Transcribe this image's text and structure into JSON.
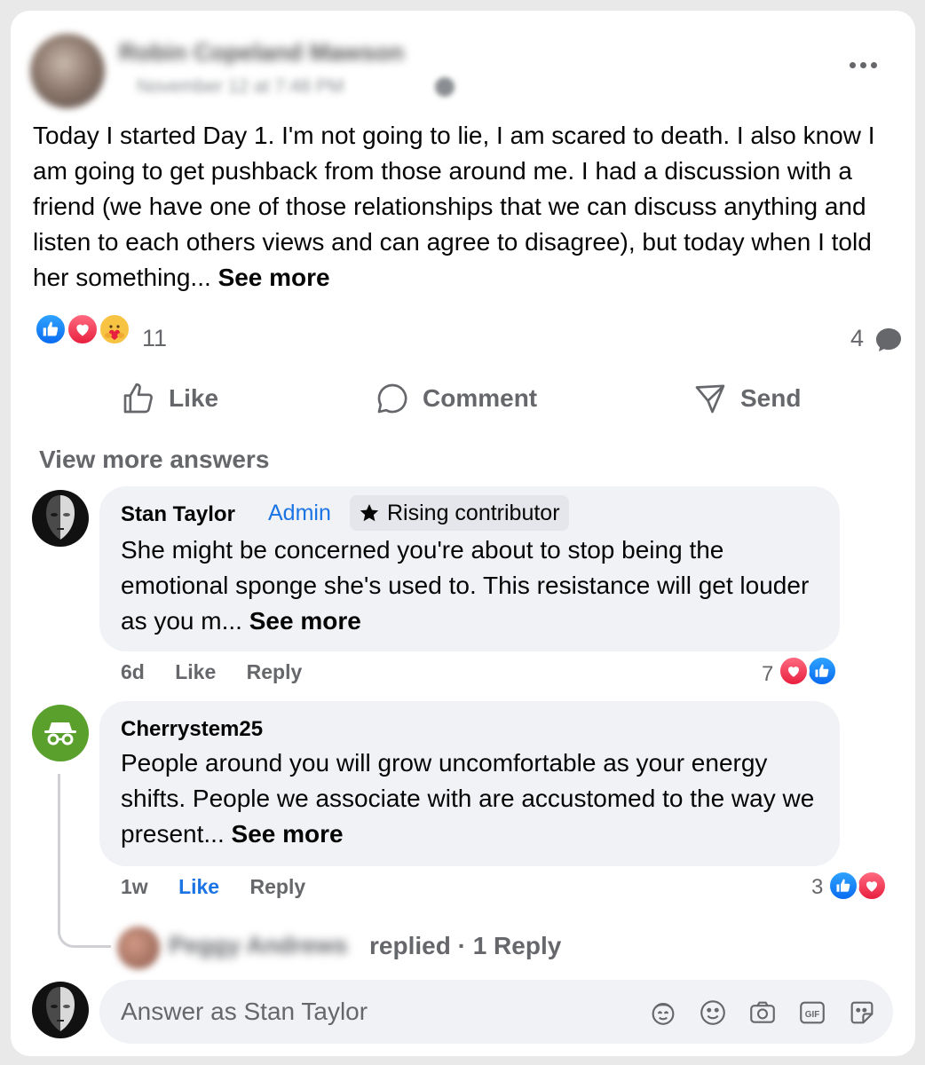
{
  "post": {
    "author_name": "Robin Copeland Mawson",
    "timestamp": "November 12 at 7:48 PM",
    "body": "Today I started Day 1. I'm not going to lie, I am scared to death. I also know I am going to get pushback from those around me. I had a discussion with a friend (we have one of those relationships that we can discuss anything and listen to each others views and can agree to disagree), but today when I told her something... ",
    "see_more": "See more",
    "reaction_count": "11",
    "reaction_types": [
      "like-icon",
      "love-icon",
      "care-icon"
    ],
    "comment_count": "4"
  },
  "actions": {
    "like": "Like",
    "comment": "Comment",
    "send": "Send"
  },
  "view_more_answers": "View more answers",
  "comments": [
    {
      "name": "Stan Taylor",
      "role": "Admin",
      "badge": "Rising contributor",
      "text": "She might be concerned you're about to stop being the emotional sponge she's used to. This resistance will get louder as you m... ",
      "see_more": "See more",
      "time": "6d",
      "like": "Like",
      "reply": "Reply",
      "reaction_count": "7",
      "reaction_types": [
        "love-icon",
        "like-icon"
      ]
    },
    {
      "name": "Cherrystem25",
      "text": "People around you will grow uncomfortable as your energy shifts. People we associate with are accustomed to the way we present... ",
      "see_more": "See more",
      "time": "1w",
      "like": "Like",
      "like_active": true,
      "reply": "Reply",
      "reaction_count": "3",
      "reaction_types": [
        "like-icon",
        "love-icon"
      ],
      "replies": {
        "replier_name": "Peggy Andrews",
        "replied": "replied",
        "separator": " · ",
        "reply_link": "1 Reply"
      }
    }
  ],
  "composer": {
    "placeholder": "Answer as Stan Taylor",
    "icons": [
      "avatar-sticker-icon",
      "emoji-icon",
      "camera-icon",
      "gif-icon",
      "sticker-icon"
    ]
  },
  "colors": {
    "accent": "#1b74e4",
    "secondary_text": "#65676b",
    "bubble": "#f0f2f5",
    "like": "#0a6bf2",
    "love": "#e8203f"
  }
}
